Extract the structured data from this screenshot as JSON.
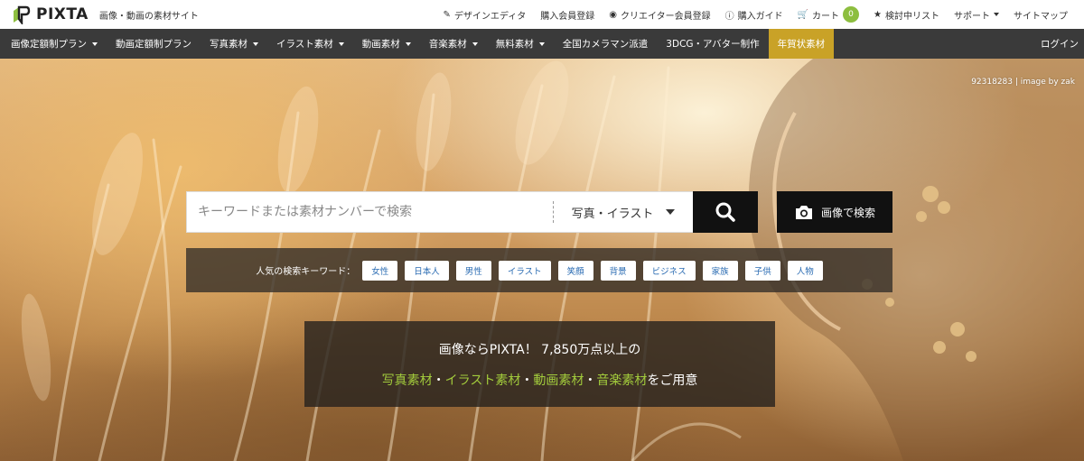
{
  "header": {
    "logo_text": "PIXTA",
    "tagline": "画像・動画の素材サイト",
    "links": [
      {
        "label": "デザインエディタ",
        "icon": "edit-icon"
      },
      {
        "label": "購入会員登録",
        "icon": ""
      },
      {
        "label": "クリエイター会員登録",
        "icon": "camera-icon"
      },
      {
        "label": "購入ガイド",
        "icon": "info-icon"
      },
      {
        "label": "カート",
        "icon": "cart-icon",
        "badge": "0"
      },
      {
        "label": "検討中リスト",
        "icon": "star-icon"
      },
      {
        "label": "サポート",
        "icon": "",
        "dropdown": true
      },
      {
        "label": "サイトマップ",
        "icon": ""
      }
    ]
  },
  "nav": {
    "items": [
      {
        "label": "画像定額制プラン",
        "dropdown": true
      },
      {
        "label": "動画定額制プラン",
        "dropdown": false
      },
      {
        "label": "写真素材",
        "dropdown": true
      },
      {
        "label": "イラスト素材",
        "dropdown": true
      },
      {
        "label": "動画素材",
        "dropdown": true
      },
      {
        "label": "音楽素材",
        "dropdown": true
      },
      {
        "label": "無料素材",
        "dropdown": true
      },
      {
        "label": "全国カメラマン派遣",
        "dropdown": false
      },
      {
        "label": "3DCG・アバター制作",
        "dropdown": false
      },
      {
        "label": "年賀状素材",
        "dropdown": false,
        "highlight": true
      }
    ],
    "login_label": "ログイン"
  },
  "hero": {
    "credit": "92318283 | image by zak",
    "search": {
      "placeholder": "キーワードまたは素材ナンバーで検索",
      "value": "",
      "category": "写真・イラスト"
    },
    "image_search_label": "画像で検索",
    "popular": {
      "label": "人気の検索キーワード：",
      "keywords": [
        "女性",
        "日本人",
        "男性",
        "イラスト",
        "笑顔",
        "背景",
        "ビジネス",
        "家族",
        "子供",
        "人物"
      ]
    },
    "promo": {
      "line1": "画像ならPIXTA！ 7,850万点以上の",
      "photo": "写真素材",
      "illust": "イラスト素材",
      "video": "動画素材",
      "music": "音楽素材",
      "sep": "・",
      "suffix": "をご用意"
    }
  },
  "colors": {
    "accent_green": "#a2cb3c",
    "nav_bg": "#3a3a3a",
    "highlight_gold": "#c9a227",
    "keyword_blue": "#2b6cb3"
  }
}
